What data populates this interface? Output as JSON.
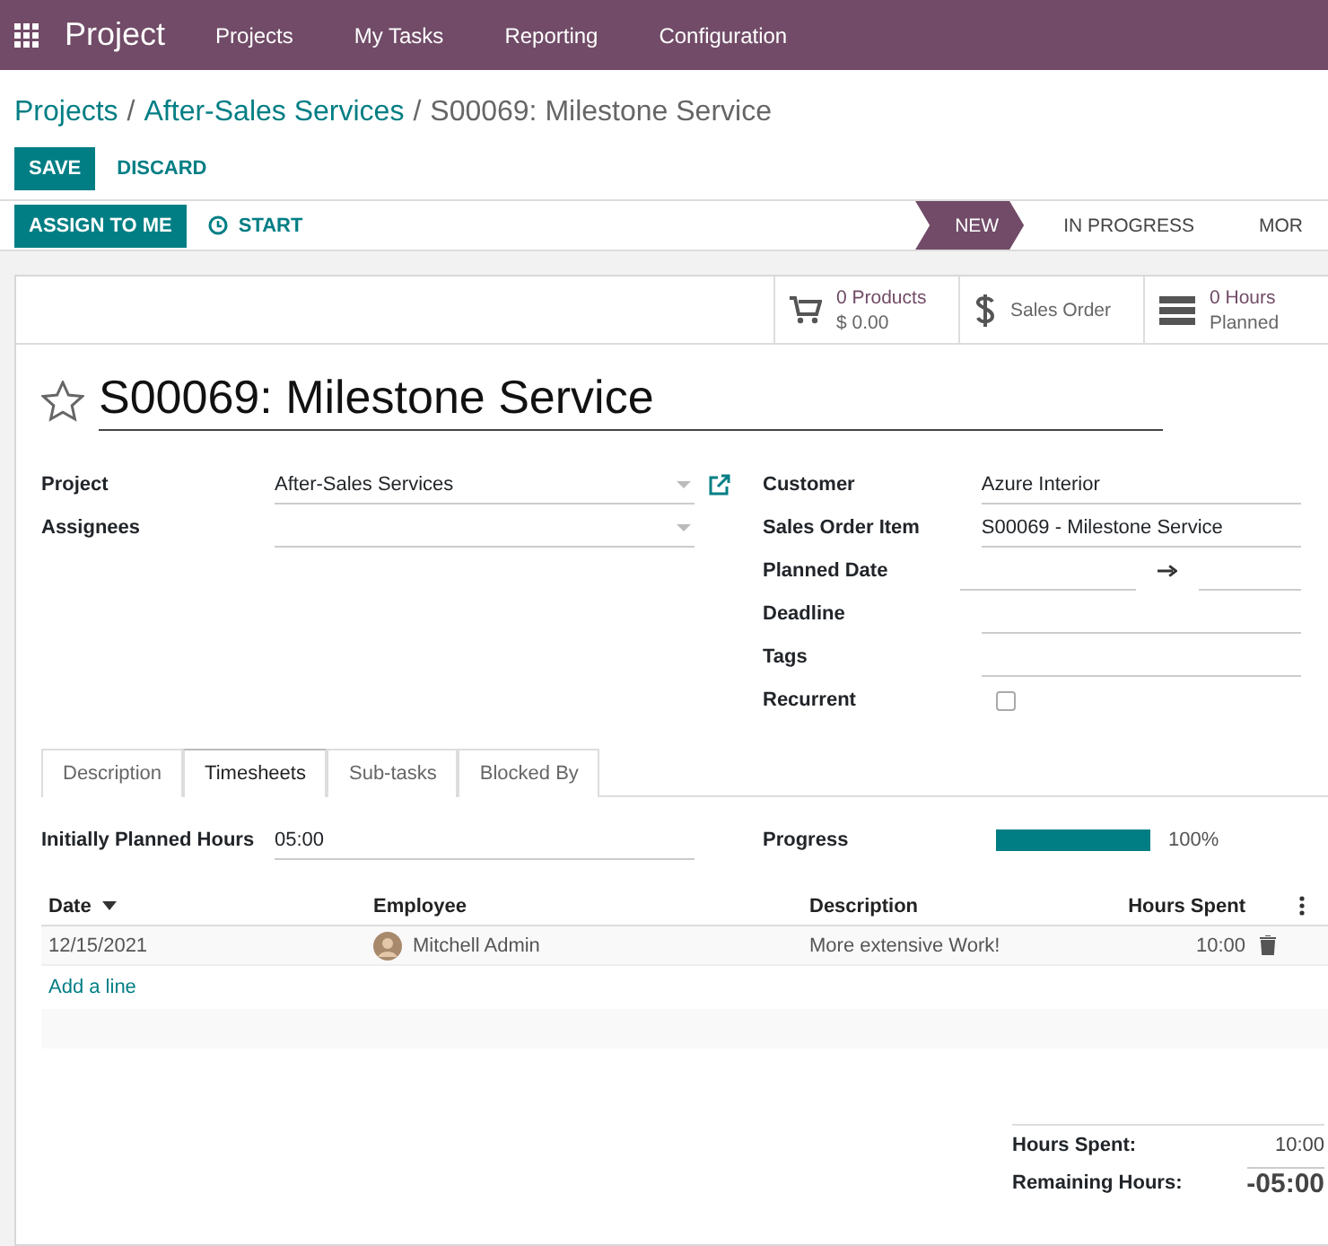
{
  "navbar": {
    "app": "Project",
    "menu": [
      "Projects",
      "My Tasks",
      "Reporting",
      "Configuration"
    ]
  },
  "breadcrumb": [
    {
      "kind": "link",
      "text": "Projects"
    },
    {
      "kind": "separator",
      "text": "/"
    },
    {
      "kind": "link",
      "text": "After-Sales Services"
    },
    {
      "kind": "separator",
      "text": "/"
    },
    {
      "kind": "current",
      "text": "S00069: Milestone Service"
    }
  ],
  "control_buttons": [
    {
      "label": "SAVE",
      "kind": "primary"
    },
    {
      "label": "DISCARD",
      "kind": "link"
    }
  ],
  "header_buttons": [
    {
      "label": "ASSIGN TO ME",
      "kind": "primary"
    },
    {
      "label": "START",
      "kind": "clock"
    }
  ],
  "stages": [
    {
      "label": "NEW",
      "selected": true
    },
    {
      "label": "IN PROGRESS",
      "selected": false
    },
    {
      "label": "MOR",
      "selected": false
    }
  ],
  "smart_buttons": [
    {
      "kind": "cart",
      "lines": [
        "0 Products",
        "$ 0.00"
      ]
    },
    {
      "kind": "dollar",
      "lines": [
        "Sales Order"
      ]
    },
    {
      "kind": "list",
      "lines": [
        "0 Hours",
        "Planned"
      ]
    }
  ],
  "title": {
    "text": "S00069: Milestone Service",
    "starred": false
  },
  "left_fields": [
    {
      "label": "Project",
      "value": "After-Sales Services",
      "kind": "many2one",
      "external_link": true
    },
    {
      "label": "Assignees",
      "kind": "many2one",
      "external_link": false
    }
  ],
  "right_fields": [
    {
      "label": "Customer",
      "value": "Azure Interior",
      "kind": "text"
    },
    {
      "label": "Sales Order Item",
      "value": "S00069 - Milestone Service",
      "kind": "text"
    },
    {
      "label": "Planned Date",
      "kind": "daterange"
    },
    {
      "label": "Deadline",
      "kind": "text"
    },
    {
      "label": "Tags",
      "kind": "text"
    },
    {
      "label": "Recurrent",
      "kind": "checkbox",
      "checked": false
    }
  ],
  "tabs": [
    {
      "label": "Description",
      "selected": false
    },
    {
      "label": "Timesheets",
      "selected": true
    },
    {
      "label": "Sub-tasks",
      "selected": false
    },
    {
      "label": "Blocked By",
      "selected": false
    }
  ],
  "timesheet": {
    "planned_label": "Initially Planned Hours",
    "planned_value": "05:00",
    "progress_label": "Progress",
    "progress": {
      "level": 1,
      "reading": "100%"
    }
  },
  "table": {
    "columns": [
      {
        "label": "Date",
        "sorted": true
      },
      {
        "label": "Employee",
        "sorted": false
      },
      {
        "label": "Description",
        "sorted": false
      },
      {
        "label": "Hours Spent",
        "sorted": false
      }
    ],
    "rows": [
      {
        "date": "12/15/2021",
        "employee": "Mitchell Admin",
        "description": "More extensive Work!",
        "hours": "10:00"
      }
    ],
    "add_line": "Add a line"
  },
  "totals": [
    {
      "label": "Hours Spent:",
      "value": "10:00",
      "kind": "normal"
    },
    {
      "label": "Remaining Hours:",
      "value": "-05:00",
      "kind": "big"
    }
  ]
}
